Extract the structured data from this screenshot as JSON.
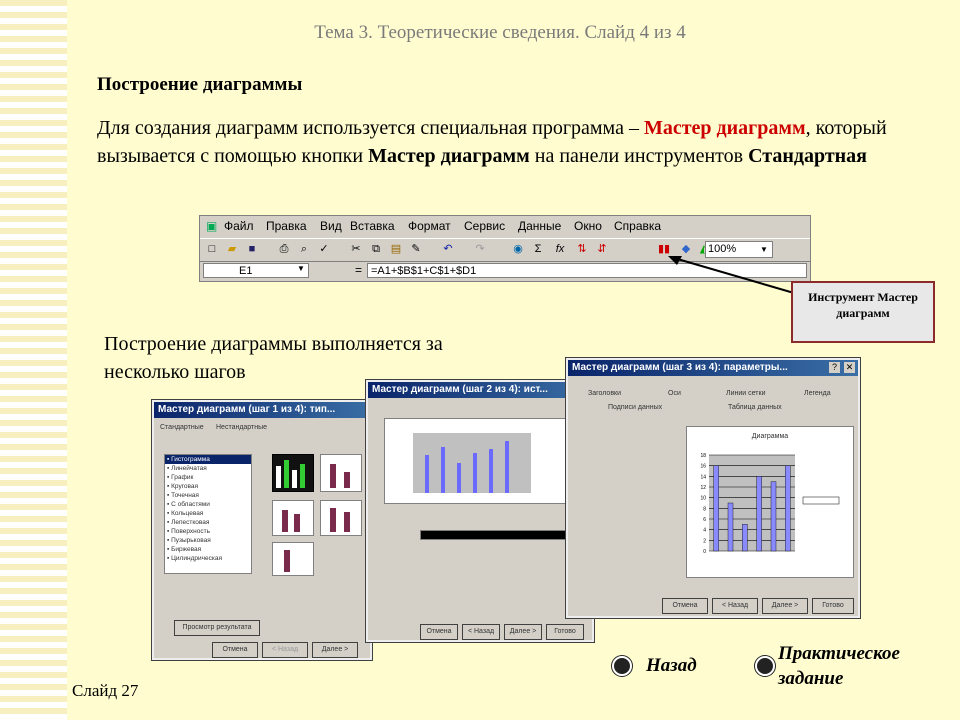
{
  "slide_title": "Тема 3. Теоретические сведения. Слайд 4 из 4",
  "heading": "Построение диаграммы",
  "para": {
    "t1": "Для создания диаграмм  используется специальная программа – ",
    "t2": "Мастер диаграмм",
    "t3": ", который вызывается с помощью кнопки ",
    "t4": "Мастер диаграмм",
    "t5": "  на панели инструментов ",
    "t6": "Стандартная"
  },
  "excel": {
    "menu": [
      "Файл",
      "Правка",
      "Вид",
      "Вставка",
      "Формат",
      "Сервис",
      "Данные",
      "Окно",
      "Справка"
    ],
    "zoom": "100%",
    "cell": "E1",
    "eq": "=",
    "formula": "=A1+$B$1+C$1+$D1"
  },
  "callout": "Инструмент Мастер диаграмм",
  "para2": "Построение диаграммы выполняется за несколько шагов",
  "dialogs": {
    "d1_title": "Мастер диаграмм (шаг 1 из 4): тип...",
    "d2_title": "Мастер диаграмм (шаг 2 из 4): ист...",
    "d3_title": "Мастер диаграмм (шаг 3 из 4): параметры...",
    "d1_tabs": [
      "Стандартные",
      "Нестандартные"
    ],
    "d1_types": [
      "Гистограмма",
      "Линейчатая",
      "График",
      "Круговая",
      "Точечная",
      "С областями",
      "Кольцевая",
      "Лепестковая",
      "Поверхность",
      "Пузырьковая",
      "Биржевая",
      "Цилиндрическая"
    ],
    "btn_cancel": "Отмена",
    "btn_back": "< Назад",
    "btn_next": "Далее >",
    "btn_finish": "Готово",
    "d3_tabs": [
      "Заголовки",
      "Оси",
      "Линии сетки",
      "Легенда",
      "Подписи данных",
      "Таблица данных"
    ],
    "d3_chart_title": "Диаграмма",
    "d3_values": [
      16,
      9,
      5,
      14,
      13,
      16
    ],
    "d3_ylim": [
      0,
      18
    ]
  },
  "nav": {
    "back": "Назад",
    "practice": "Практическое задание"
  },
  "footer": "Слайд 27"
}
